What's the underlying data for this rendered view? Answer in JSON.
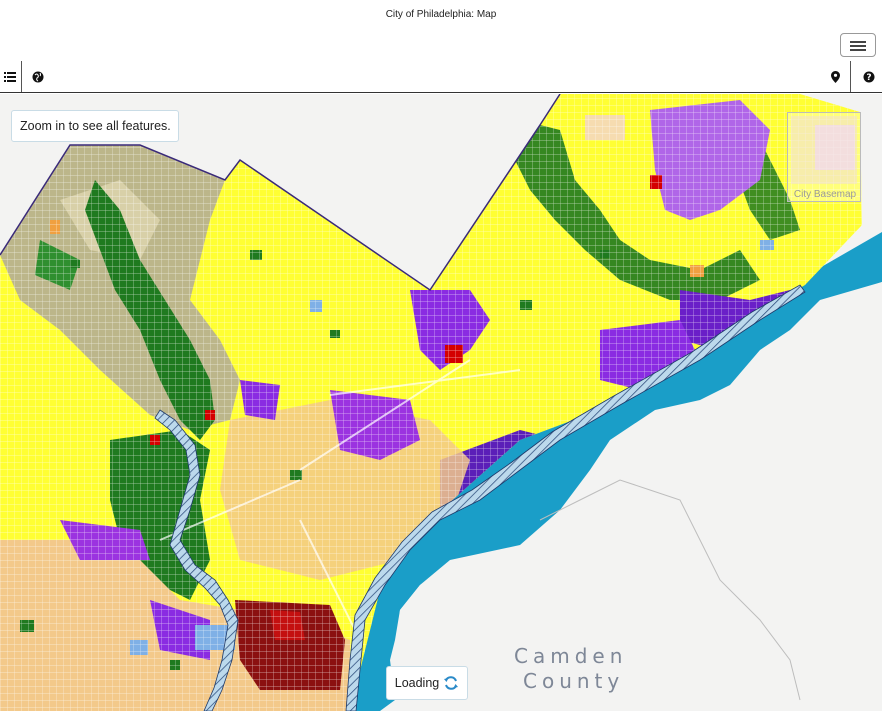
{
  "header": {
    "title": "City of Philadelphia: Map"
  },
  "toolbar": {
    "menu_icon": "hamburger-menu-icon",
    "layers_icon": "list-icon",
    "basemap_icon": "globe-icon",
    "location_icon": "map-marker-icon",
    "help_icon": "help-circle-icon"
  },
  "map": {
    "zoom_notice": "Zoom in to see all features.",
    "basemap_toggle_label": "City Basemap",
    "loading_label": "Loading",
    "county_label_line1": "Camden",
    "county_label_line2": "County",
    "colors": {
      "residential_low": "#ffff33",
      "residential_medium": "#f3c98a",
      "commercial": "#8a2be2",
      "industrial": "#b066e8",
      "park": "#1f7a1f",
      "institutional": "#7fb0e6",
      "transportation": "#d40000",
      "water": "#1a9ec8",
      "background": "#f3f3f2"
    }
  }
}
